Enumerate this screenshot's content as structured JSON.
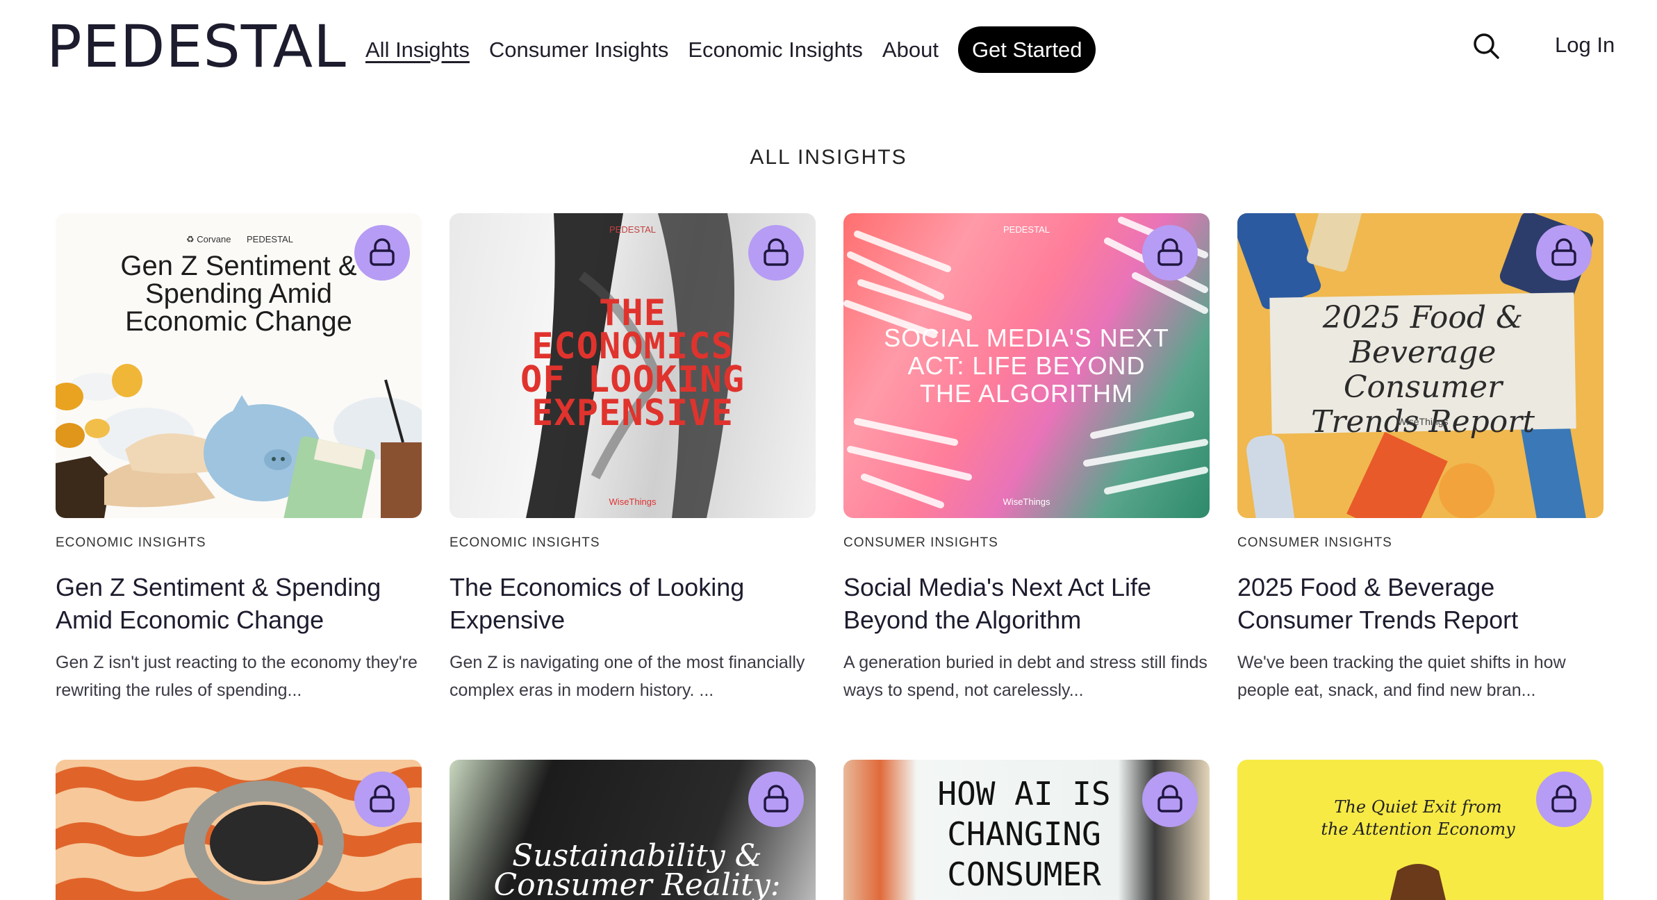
{
  "brand": {
    "logo": "PEDESTAL"
  },
  "nav": {
    "items": [
      {
        "label": "All Insights",
        "active": true
      },
      {
        "label": "Consumer Insights"
      },
      {
        "label": "Economic Insights"
      },
      {
        "label": "About"
      }
    ],
    "cta": "Get Started",
    "search_icon": "search-icon",
    "login": "Log In"
  },
  "section_title": "ALL INSIGHTS",
  "colors": {
    "lock_badge": "#b69cf4",
    "cta_bg": "#000000"
  },
  "cards": [
    {
      "category": "ECONOMIC INSIGHTS",
      "title": "Gen Z Sentiment & Spending Amid Economic Change",
      "excerpt": "Gen Z isn't just reacting to the economy they're rewriting the rules of spending...",
      "locked": true,
      "image": {
        "brand_left": "Corvane",
        "brand_right": "PEDESTAL",
        "heading": [
          "Gen Z Sentiment &",
          "Spending Amid",
          "Economic Change"
        ]
      }
    },
    {
      "category": "ECONOMIC INSIGHTS",
      "title": "The Economics of Looking Expensive",
      "excerpt": "Gen Z is navigating one of the most financially complex eras in modern history. ...",
      "locked": true,
      "image": {
        "brand_top": "PEDESTAL",
        "heading": [
          "THE",
          "ECONOMICS",
          "OF LOOKING",
          "EXPENSIVE"
        ],
        "brand_bottom": "WiseThings"
      }
    },
    {
      "category": "CONSUMER INSIGHTS",
      "title": "Social Media's Next Act Life Beyond the Algorithm",
      "excerpt": "A generation buried in debt and stress still finds ways to spend, not carelessly...",
      "locked": true,
      "image": {
        "brand_top": "PEDESTAL",
        "heading": [
          "SOCIAL MEDIA'S NEXT",
          "ACT: LIFE BEYOND",
          "THE ALGORITHM"
        ],
        "brand_bottom": "WiseThings"
      }
    },
    {
      "category": "CONSUMER INSIGHTS",
      "title": "2025 Food & Beverage Consumer Trends Report",
      "excerpt": "We've been tracking the quiet shifts in how people eat, snack, and find new bran...",
      "locked": true,
      "image": {
        "heading": [
          "2025 Food &",
          "Beverage Consumer",
          "Trends Report"
        ],
        "brand_bottom": "WiseThings"
      }
    },
    {
      "locked": true,
      "image": {}
    },
    {
      "locked": true,
      "image": {
        "heading": [
          "Sustainability &",
          "Consumer Reality:"
        ]
      }
    },
    {
      "locked": true,
      "image": {
        "heading": [
          "HOW AI IS",
          "CHANGING",
          "CONSUMER"
        ]
      }
    },
    {
      "locked": true,
      "image": {
        "heading": [
          "The Quiet Exit from",
          "the Attention Economy"
        ]
      }
    }
  ]
}
